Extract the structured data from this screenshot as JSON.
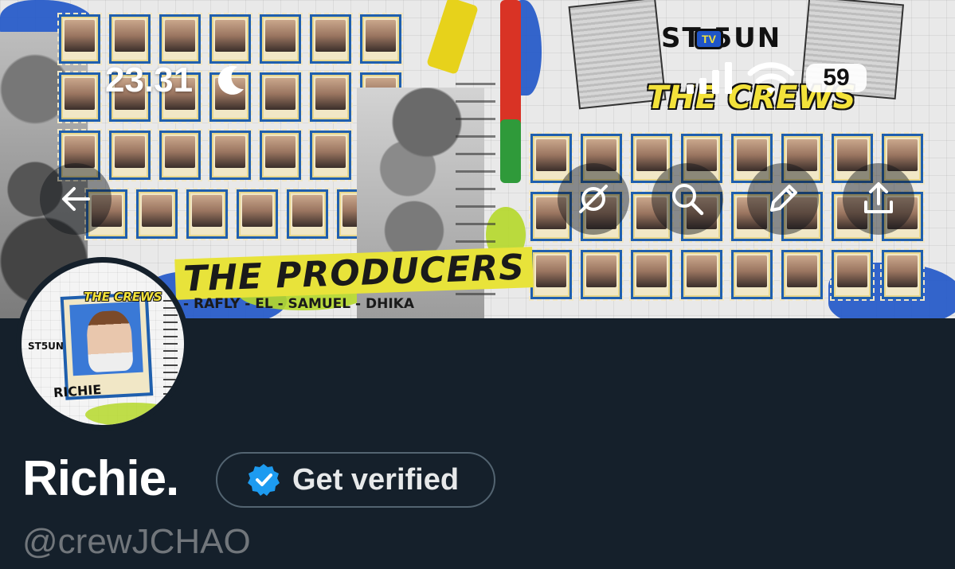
{
  "status_bar": {
    "time": "23.31",
    "battery": "59"
  },
  "banner": {
    "producers_title": "THE PRODUCERS",
    "producers_names": "- RAFLY - EL - SAMUEL - DHIKA",
    "crews_title": "THE CREWS",
    "logo_text": "ST 5UN",
    "logo_tv": "TV"
  },
  "avatar": {
    "crews_label": "THE CREWS",
    "name_label": "RICHIE",
    "logo_label": "ST5UN"
  },
  "profile": {
    "display_name": "Richie.",
    "verify_label": "Get verified",
    "handle": "@crewJCHAO"
  },
  "colors": {
    "background": "#15202b",
    "verified_blue": "#1d9bf0",
    "handle_gray": "#71767b",
    "button_border": "#536471"
  },
  "icons": {
    "back": "arrow-left-icon",
    "grok": "grok-icon",
    "search": "search-icon",
    "edit": "pencil-icon",
    "share": "share-icon",
    "verified": "verified-badge-icon"
  }
}
